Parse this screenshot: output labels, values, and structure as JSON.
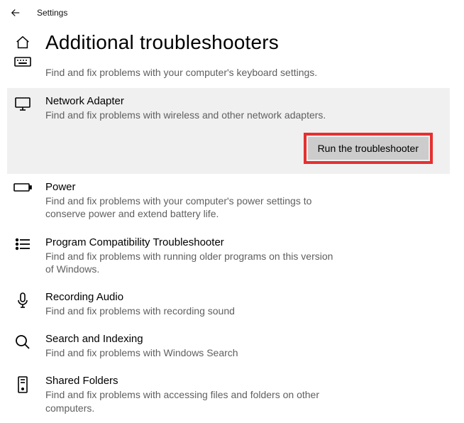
{
  "topbar": {
    "label": "Settings"
  },
  "page": {
    "title": "Additional troubleshooters"
  },
  "intro": {
    "desc": "Find and fix problems with your computer's keyboard settings."
  },
  "runButton": {
    "label": "Run the troubleshooter"
  },
  "items": {
    "network": {
      "name": "Network Adapter",
      "desc": "Find and fix problems with wireless and other network adapters."
    },
    "power": {
      "name": "Power",
      "desc": "Find and fix problems with your computer's power settings to conserve power and extend battery life."
    },
    "compat": {
      "name": "Program Compatibility Troubleshooter",
      "desc": "Find and fix problems with running older programs on this version of Windows."
    },
    "audio": {
      "name": "Recording Audio",
      "desc": "Find and fix problems with recording sound"
    },
    "search": {
      "name": "Search and Indexing",
      "desc": "Find and fix problems with Windows Search"
    },
    "shared": {
      "name": "Shared Folders",
      "desc": "Find and fix problems with accessing files and folders on other computers."
    }
  }
}
